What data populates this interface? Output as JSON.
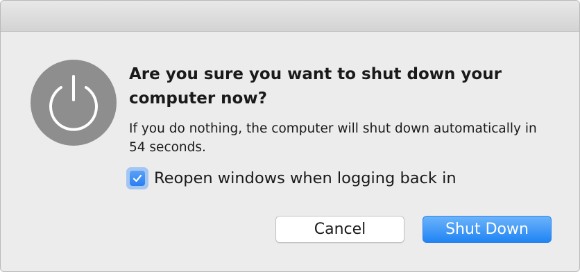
{
  "dialog": {
    "title": "Are you sure you want to shut down your computer now?",
    "message": "If you do nothing, the computer will shut down automatically in 54 seconds.",
    "checkbox": {
      "label": "Reopen windows when logging back in",
      "checked": true
    },
    "buttons": {
      "cancel_label": "Cancel",
      "primary_label": "Shut Down"
    },
    "icon": "power-icon"
  },
  "colors": {
    "background": "#ececec",
    "icon_fill": "#8e8e8e",
    "accent": "#1f84f4",
    "checkbox_fill": "#2a7ef2"
  }
}
